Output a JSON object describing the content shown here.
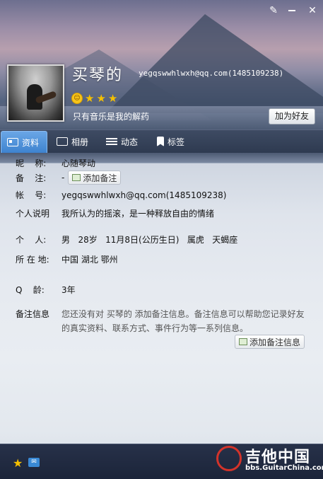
{
  "header": {
    "nickname": "买琴的",
    "account": "yegqswwhlwxh@qq.com(1485109238)",
    "signature": "只有音乐是我的解药",
    "add_friend": "加为好友",
    "level_stars": 3
  },
  "tabs": [
    {
      "label": "资料"
    },
    {
      "label": "相册"
    },
    {
      "label": "动态"
    },
    {
      "label": "标签"
    }
  ],
  "profile": {
    "nick_label": "昵    称:",
    "nick_value": "心随琴动",
    "remark_label": "备    注:",
    "remark_value": "-",
    "add_remark_btn": "添加备注",
    "account_label": "帐    号:",
    "account_value": "yegqswwhlwxh@qq.com(1485109238)",
    "bio_label": "个人说明",
    "bio_value": "我所认为的摇滚，是一种释放自由的情绪",
    "person_label": "个    人:",
    "person_value": "男   28岁   11月8日(公历生日)   属虎   天蝎座",
    "location_label": "所 在 地:",
    "location_value": "中国 湖北 鄂州",
    "qage_label": "Q    龄:",
    "qage_value": "3年",
    "remark_info_label": "备注信息",
    "remark_info_text": "您还没有对 买琴的 添加备注信息。备注信息可以帮助您记录好友的真实资料、联系方式、事件行为等一系列信息。",
    "add_remark_info_btn": "添加备注信息"
  },
  "footer": {
    "logo_text": "吉他中国",
    "logo_url": "bbs.GuitarChina.com"
  },
  "window_controls": [
    "skin-icon",
    "minimize-icon",
    "close-icon"
  ]
}
